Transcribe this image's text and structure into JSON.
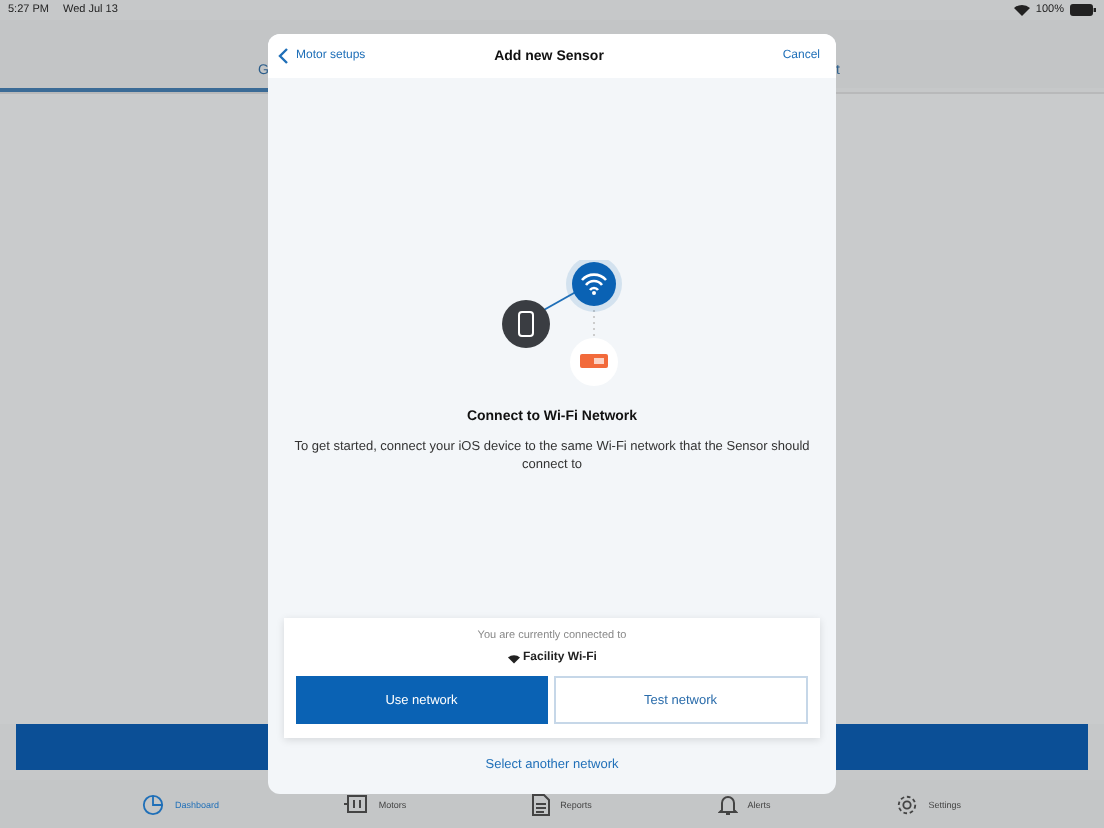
{
  "status_bar": {
    "time": "5:27 PM",
    "date": "Wed Jul 13",
    "battery": "100%"
  },
  "background": {
    "tab_left": "G",
    "tab_right": "t"
  },
  "modal": {
    "back": "Motor setups",
    "title": "Add new Sensor",
    "cancel": "Cancel",
    "heading": "Connect to Wi-Fi Network",
    "description": "To get started, connect your iOS device to the same Wi-Fi network that the Sensor should connect to",
    "connection": {
      "caption": "You are currently connected to",
      "network": "Facility Wi-Fi"
    },
    "buttons": [
      {
        "label": "Use network",
        "kind": "primary"
      },
      {
        "label": "Test network",
        "kind": "secondary"
      }
    ],
    "link": "Select another network"
  },
  "tab_bar": [
    {
      "label": "Dashboard",
      "kind": "dashboard",
      "selected": true
    },
    {
      "label": "Motors",
      "kind": "motors",
      "selected": false
    },
    {
      "label": "Reports",
      "kind": "reports",
      "selected": false
    },
    {
      "label": "Alerts",
      "kind": "alerts",
      "selected": false
    },
    {
      "label": "Settings",
      "kind": "settings",
      "selected": false
    }
  ]
}
